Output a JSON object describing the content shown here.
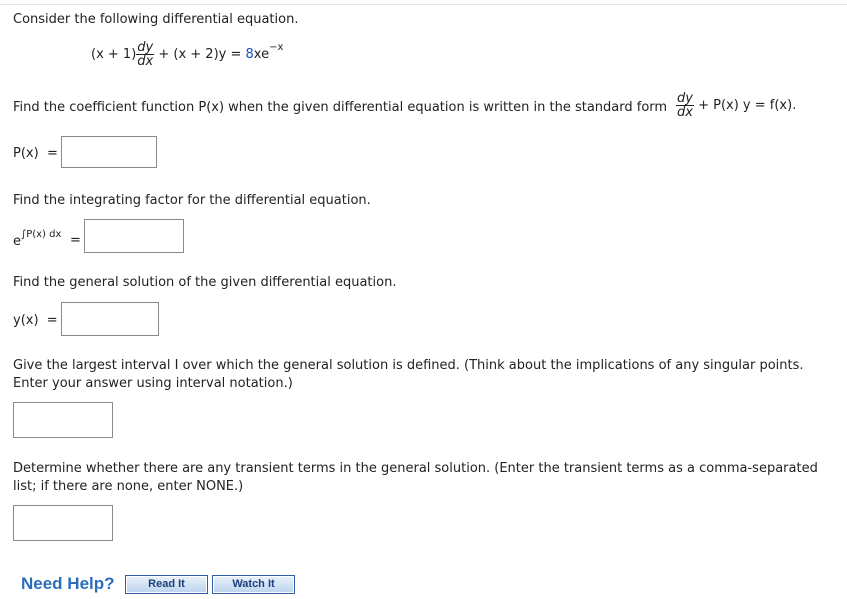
{
  "intro": "Consider the following differential equation.",
  "equation": {
    "left": "(x + 1)",
    "dy": "dy",
    "dx": "dx",
    "middle": " + (x + 2)y = ",
    "rhs_coef": "8",
    "rhs_base": "xe",
    "rhs_exp": "−x"
  },
  "q1": {
    "text": "Find the coefficient function P(x) when the given differential equation is written in the standard form",
    "std_dy": "dy",
    "std_dx": "dx",
    "std_rest": "+ P(x) y = f(x).",
    "label": "P(x)  =",
    "value": ""
  },
  "q2": {
    "text": "Find the integrating factor for the differential equation.",
    "label_base": "e",
    "label_exp": "∫P(x) dx",
    "label_eq": "=",
    "value": ""
  },
  "q3": {
    "text": "Find the general solution of the given differential equation.",
    "label": "y(x)  =",
    "value": ""
  },
  "q4": {
    "line1": "Give the largest interval I over which the general solution is defined. (Think about the implications of any singular points.",
    "line2": "Enter your answer using interval notation.)",
    "value": ""
  },
  "q5": {
    "line1": "Determine whether there are any transient terms in the general solution. (Enter the transient terms as a comma-separated",
    "line2": "list; if there are none, enter NONE.)",
    "value": ""
  },
  "help": {
    "title": "Need Help?",
    "read": "Read It",
    "watch": "Watch It"
  },
  "colors": {
    "accent_blue": "#2a6ebb",
    "rhs_coef": "#1a4fc0"
  }
}
